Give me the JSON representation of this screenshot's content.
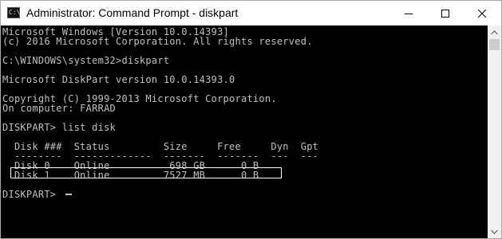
{
  "window": {
    "title": "Administrator: Command Prompt - diskpart",
    "icon_label": "C:\\",
    "minimize_icon": "minimize-icon",
    "maximize_icon": "maximize-icon",
    "close_icon": "close-icon"
  },
  "console": {
    "lines": [
      "Microsoft Windows [Version 10.0.14393]",
      "(c) 2016 Microsoft Corporation. All rights reserved.",
      "",
      "C:\\WINDOWS\\system32>diskpart",
      "",
      "Microsoft DiskPart version 10.0.14393.0",
      "",
      "Copyright (C) 1999-2013 Microsoft Corporation.",
      "On computer: FARRAD",
      "",
      "DISKPART> list disk",
      "",
      "  Disk ###  Status         Size     Free     Dyn  Gpt",
      "  --------  -------------  -------  -------  ---  ---",
      "  Disk 0    Online          698 GB      0 B",
      "  Disk 1    Online         7527 MB      0 B",
      "",
      "DISKPART> "
    ]
  },
  "disk_table": {
    "headers": [
      "Disk ###",
      "Status",
      "Size",
      "Free",
      "Dyn",
      "Gpt"
    ],
    "rows": [
      {
        "disk": "Disk 0",
        "status": "Online",
        "size": "698 GB",
        "free": "0 B",
        "dyn": "",
        "gpt": ""
      },
      {
        "disk": "Disk 1",
        "status": "Online",
        "size": "7527 MB",
        "free": "0 B",
        "dyn": "",
        "gpt": ""
      }
    ]
  },
  "colors": {
    "console_bg": "#000000",
    "console_text": "#c0c0c0",
    "titlebar_bg": "#ffffff",
    "highlight_border": "#ffffff"
  }
}
